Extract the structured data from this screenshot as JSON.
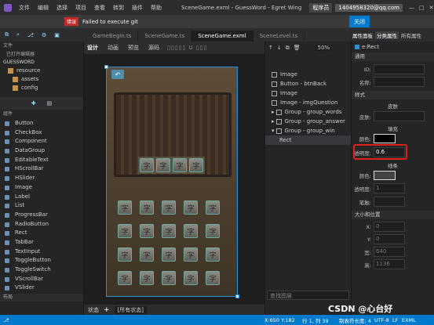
{
  "app": {
    "title": "SceneGame.exml - GuessWord - Egret Wing",
    "user_label": "程序员",
    "email": "1404958320@qq.com",
    "close_label": "关闭"
  },
  "menu": [
    "文件",
    "编辑",
    "选择",
    "项目",
    "查看",
    "转到",
    "插件",
    "帮助"
  ],
  "error": {
    "badge": "错误",
    "message": "Failed to execute git"
  },
  "tabs": [
    "GameBegin.ts",
    "SceneGame.ts",
    "SceneGame.exml",
    "SceneLevel.ts"
  ],
  "editor_toolbar": {
    "design": "设计",
    "animation": "动画",
    "preview": "预览",
    "source": "源码",
    "zoom": "50%"
  },
  "left": {
    "file_header": "文件",
    "open_editors": "已打开编辑器",
    "project": "GUESSWORD",
    "tree": [
      "resource",
      "assets",
      "config"
    ],
    "components_header": "组件",
    "components": [
      "Button",
      "CheckBox",
      "Component",
      "DataGroup",
      "EditableText",
      "HScrollBar",
      "HSlider",
      "Image",
      "Label",
      "List",
      "ProgressBar",
      "RadioButton",
      "Rect",
      "TabBar",
      "TextInput",
      "ToggleButton",
      "ToggleSwitch",
      "VScrollBar",
      "VSlider"
    ],
    "layout": "布局"
  },
  "layers": {
    "items": [
      "Image",
      "Button - btnBack",
      "Image",
      "Image - imgQuestion",
      "Group - group_words",
      "Group - group_answer",
      "Group - group_win",
      "Rect"
    ],
    "search_placeholder": "查找图层"
  },
  "props": {
    "tabs": [
      "属性面板",
      "分类属性",
      "所有属性"
    ],
    "element": "e:Rect",
    "general": "通用",
    "id_label": "ID:",
    "name_label": "名称:",
    "style": "样式",
    "skin_title": "皮肤",
    "skin_label": "皮肤:",
    "fill_title": "填充",
    "color_label": "颜色:",
    "alpha_label": "透明度:",
    "alpha_value": "0.6",
    "stroke_title": "线条",
    "stroke_color_label": "颜色:",
    "stroke_alpha_label": "透明度:",
    "stroke_alpha_value": "1",
    "stroke_width_label": "笔触:",
    "size_section": "大小和位置",
    "x_label": "X:",
    "x_value": "0",
    "y_label": "Y:",
    "y_value": "0",
    "w_label": "宽:",
    "w_value": "640",
    "h_label": "高:",
    "h_value": "1136",
    "fill_color": "#000000",
    "stroke_color": "#444444"
  },
  "board": {
    "slot_char": "字"
  },
  "status": {
    "state": "状态",
    "all_layers": "[所有状态]",
    "coords": "X:650 Y:182",
    "cursor": "行 1, 列 39",
    "tabs": "制表符长度: 4",
    "encoding": "UTF-8",
    "eol": "LF",
    "lang": "EXML",
    "watermark": "CSDN @心台好"
  },
  "colors": {
    "accent": "#007acc",
    "highlight": "#e0201c"
  }
}
